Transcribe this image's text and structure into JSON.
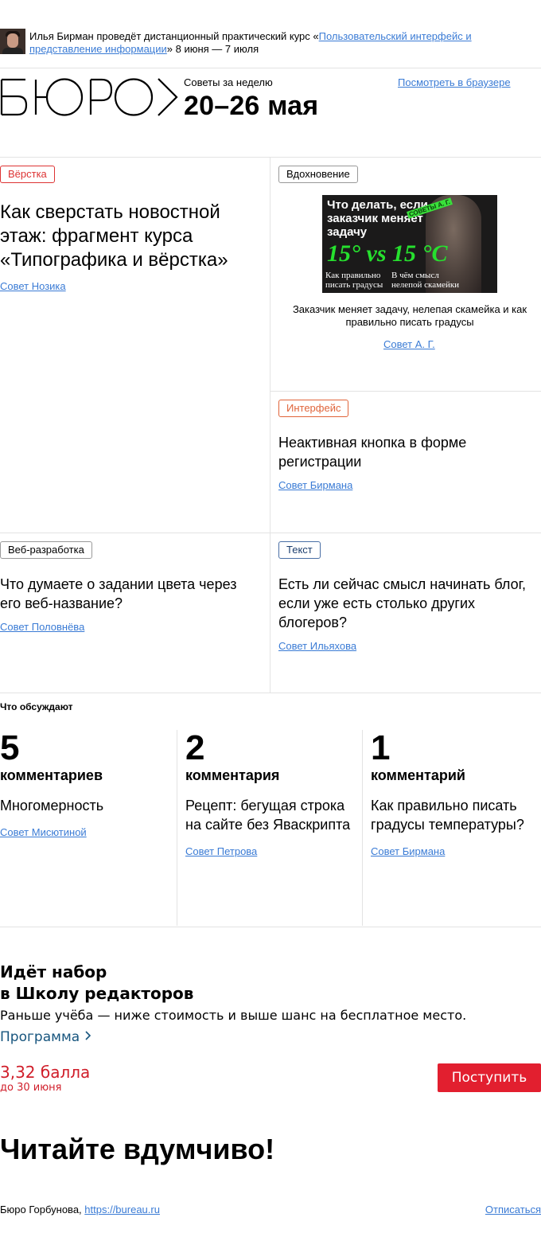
{
  "promo": {
    "text_before": "Илья Бирман проведёт дистанционный практический курс «",
    "link_text": "Пользовательский интерфейс и представление информации",
    "text_after": "» 8 июня — 7 июля"
  },
  "header": {
    "logo_text": "БЮРО",
    "week_label": "Советы за неделю",
    "week_title": "20–26 мая",
    "browser_link": "Посмотреть в браузере"
  },
  "cards": [
    {
      "tag": "Вёрстка",
      "title": "Как сверстать новостной этаж: фрагмент курса «Типографика и вёрстка»",
      "author": "Совет Нозика"
    },
    {
      "tag": "Вдохновение",
      "title": "Заказчик меняет задачу, нелепая скамейка и как правильно писать градусы",
      "author": "Совет А. Г.",
      "thumb": {
        "line1": "Что делать, если заказчик меняет задачу",
        "badge": "СОВЕТЫ А. Г.",
        "temps": "15° vs 15 °C",
        "left_caption": "Как правильно писать градусы",
        "right_caption": "В чём смысл нелепой скамейки"
      }
    },
    {
      "tag": "Интерфейс",
      "title": "Неактивная кнопка в форме регистрации",
      "author": "Совет Бирмана"
    },
    {
      "tag": "Веб-разработка",
      "title": "Что думаете о задании цвета через его веб-название?",
      "author": "Совет Половнёва"
    },
    {
      "tag": "Текст",
      "title": "Есть ли сейчас смысл начинать блог, если уже есть столько других блогеров?",
      "author": "Совет Ильяхова"
    }
  ],
  "discussed": {
    "label": "Что обсуждают",
    "items": [
      {
        "count": "5",
        "word": "комментариев",
        "title": "Многомерность",
        "author": "Совет Мисютиной"
      },
      {
        "count": "2",
        "word": "комментария",
        "title": "Рецепт: бегущая строка на сайте без Яваскрипта",
        "author": "Совет Петрова"
      },
      {
        "count": "1",
        "word": "комментарий",
        "title": "Как правильно писать градусы температуры?",
        "author": "Совет Бирмана"
      }
    ]
  },
  "school": {
    "title_line1": "Идёт набор",
    "title_line2": "в Школу редакторов",
    "subtitle": "Раньше учёба — ниже стоимость и выше шанс на бесплатное место.",
    "program": "Программа",
    "price": "3,32 балла",
    "deadline": "до 30 июня",
    "enroll": "Поступить"
  },
  "read_title": "Читайте вдумчиво!",
  "footer": {
    "company": "Бюро Горбунова,",
    "site": "https://bureau.ru",
    "unsubscribe": "Отписаться"
  }
}
